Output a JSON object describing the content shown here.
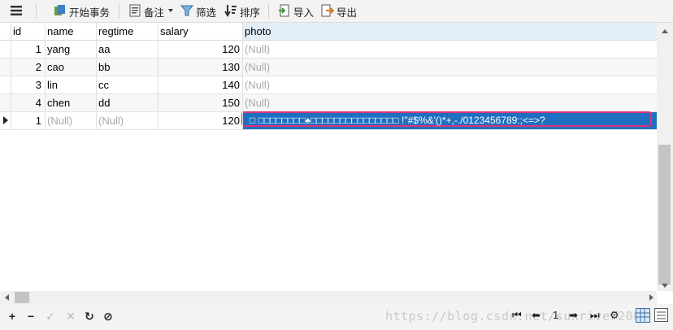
{
  "toolbar": {
    "begin_transaction": "开始事务",
    "memo": "备注",
    "filter": "筛选",
    "sort": "排序",
    "import": "导入",
    "export": "导出"
  },
  "table": {
    "columns": [
      "id",
      "name",
      "regtime",
      "salary",
      "photo"
    ],
    "rows": [
      {
        "id": "1",
        "name": "yang",
        "regtime": "aa",
        "salary": "120",
        "photo": "(Null)"
      },
      {
        "id": "2",
        "name": "cao",
        "regtime": "bb",
        "salary": "130",
        "photo": "(Null)"
      },
      {
        "id": "3",
        "name": "lin",
        "regtime": "cc",
        "salary": "140",
        "photo": "(Null)"
      },
      {
        "id": "4",
        "name": "chen",
        "regtime": "dd",
        "salary": "150",
        "photo": "(Null)"
      }
    ],
    "new_row": {
      "id": "1",
      "name": "(Null)",
      "regtime": "(Null)",
      "salary": "120",
      "photo": "□ □□□□□□□□♠□□□□□□□□□□□□□□□ !\"#$%&'()*+,-./0123456789:;<=>?"
    }
  },
  "pager": {
    "page": "1"
  },
  "watermark": "https://blog.csdn.net/sunriver2000",
  "colors": {
    "selection": "#1f6fc0",
    "highlight_border": "#e0317a",
    "null_text": "#a8a8a8"
  }
}
